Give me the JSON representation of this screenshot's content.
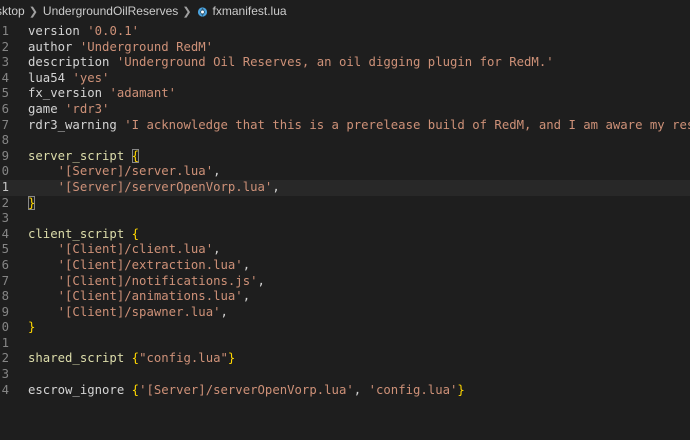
{
  "breadcrumb": {
    "items": [
      {
        "label": "sktop"
      },
      {
        "label": "UndergroundOilReserves"
      }
    ],
    "file": "fxmanifest.lua",
    "file_icon": "fivem-manifest-icon"
  },
  "colors": {
    "background": "#1e1e1e",
    "identifier": "#d4d4d4",
    "string": "#ce9178",
    "function": "#dcdcaa",
    "brace": "#ffd700",
    "line_number": "#858585"
  },
  "editor": {
    "current_line": "1",
    "lines": [
      {
        "n": "1",
        "tokens": [
          {
            "t": "version",
            "k": "ident"
          },
          {
            "t": " ",
            "k": "ws"
          },
          {
            "t": "'0.0.1'",
            "k": "str"
          }
        ]
      },
      {
        "n": "2",
        "tokens": [
          {
            "t": "author",
            "k": "ident"
          },
          {
            "t": " ",
            "k": "ws"
          },
          {
            "t": "'Underground RedM'",
            "k": "str"
          }
        ]
      },
      {
        "n": "3",
        "tokens": [
          {
            "t": "description",
            "k": "ident"
          },
          {
            "t": " ",
            "k": "ws"
          },
          {
            "t": "'Underground Oil Reserves, an oil digging plugin for RedM.'",
            "k": "str"
          }
        ]
      },
      {
        "n": "4",
        "tokens": [
          {
            "t": "lua54",
            "k": "ident"
          },
          {
            "t": " ",
            "k": "ws"
          },
          {
            "t": "'yes'",
            "k": "str"
          }
        ]
      },
      {
        "n": "5",
        "tokens": [
          {
            "t": "fx_version",
            "k": "ident"
          },
          {
            "t": " ",
            "k": "ws"
          },
          {
            "t": "'adamant'",
            "k": "str"
          }
        ]
      },
      {
        "n": "6",
        "tokens": [
          {
            "t": "game",
            "k": "ident"
          },
          {
            "t": " ",
            "k": "ws"
          },
          {
            "t": "'rdr3'",
            "k": "str"
          }
        ]
      },
      {
        "n": "7",
        "tokens": [
          {
            "t": "rdr3_warning",
            "k": "ident"
          },
          {
            "t": " ",
            "k": "ws"
          },
          {
            "t": "'I acknowledge that this is a prerelease build of RedM, and I am aware my resources *",
            "k": "str"
          }
        ]
      },
      {
        "n": "8",
        "tokens": []
      },
      {
        "n": "9",
        "tokens": [
          {
            "t": "server_script",
            "k": "fn"
          },
          {
            "t": " ",
            "k": "ws"
          },
          {
            "t": "{",
            "k": "brace-match"
          }
        ]
      },
      {
        "n": "0",
        "tokens": [
          {
            "t": "    ",
            "k": "ws"
          },
          {
            "t": "'[Server]/server.lua'",
            "k": "str"
          },
          {
            "t": ",",
            "k": "ident"
          }
        ]
      },
      {
        "n": "1",
        "tokens": [
          {
            "t": "    ",
            "k": "ws"
          },
          {
            "t": "'[Server]/serverOpenVorp.lua'",
            "k": "str"
          },
          {
            "t": ",",
            "k": "ident"
          }
        ]
      },
      {
        "n": "2",
        "tokens": [
          {
            "t": "}",
            "k": "brace-match"
          }
        ]
      },
      {
        "n": "3",
        "tokens": []
      },
      {
        "n": "4",
        "tokens": [
          {
            "t": "client_script",
            "k": "fn"
          },
          {
            "t": " ",
            "k": "ws"
          },
          {
            "t": "{",
            "k": "brace"
          }
        ]
      },
      {
        "n": "5",
        "tokens": [
          {
            "t": "    ",
            "k": "ws"
          },
          {
            "t": "'[Client]/client.lua'",
            "k": "str"
          },
          {
            "t": ",",
            "k": "ident"
          }
        ]
      },
      {
        "n": "6",
        "tokens": [
          {
            "t": "    ",
            "k": "ws"
          },
          {
            "t": "'[Client]/extraction.lua'",
            "k": "str"
          },
          {
            "t": ",",
            "k": "ident"
          }
        ]
      },
      {
        "n": "7",
        "tokens": [
          {
            "t": "    ",
            "k": "ws"
          },
          {
            "t": "'[Client]/notifications.js'",
            "k": "str"
          },
          {
            "t": ",",
            "k": "ident"
          }
        ]
      },
      {
        "n": "8",
        "tokens": [
          {
            "t": "    ",
            "k": "ws"
          },
          {
            "t": "'[Client]/animations.lua'",
            "k": "str"
          },
          {
            "t": ",",
            "k": "ident"
          }
        ]
      },
      {
        "n": "9",
        "tokens": [
          {
            "t": "    ",
            "k": "ws"
          },
          {
            "t": "'[Client]/spawner.lua'",
            "k": "str"
          },
          {
            "t": ",",
            "k": "ident"
          }
        ]
      },
      {
        "n": "0",
        "tokens": [
          {
            "t": "}",
            "k": "brace"
          }
        ]
      },
      {
        "n": "1",
        "tokens": []
      },
      {
        "n": "2",
        "tokens": [
          {
            "t": "shared_script",
            "k": "fn"
          },
          {
            "t": " ",
            "k": "ws"
          },
          {
            "t": "{",
            "k": "brace"
          },
          {
            "t": "\"config.lua\"",
            "k": "str"
          },
          {
            "t": "}",
            "k": "brace"
          }
        ]
      },
      {
        "n": "3",
        "tokens": []
      },
      {
        "n": "4",
        "tokens": [
          {
            "t": "escrow_ignore",
            "k": "ident"
          },
          {
            "t": " ",
            "k": "ws"
          },
          {
            "t": "{",
            "k": "brace"
          },
          {
            "t": "'[Server]/serverOpenVorp.lua'",
            "k": "str"
          },
          {
            "t": ", ",
            "k": "ident"
          },
          {
            "t": "'config.lua'",
            "k": "str"
          },
          {
            "t": "}",
            "k": "brace"
          }
        ]
      }
    ]
  }
}
